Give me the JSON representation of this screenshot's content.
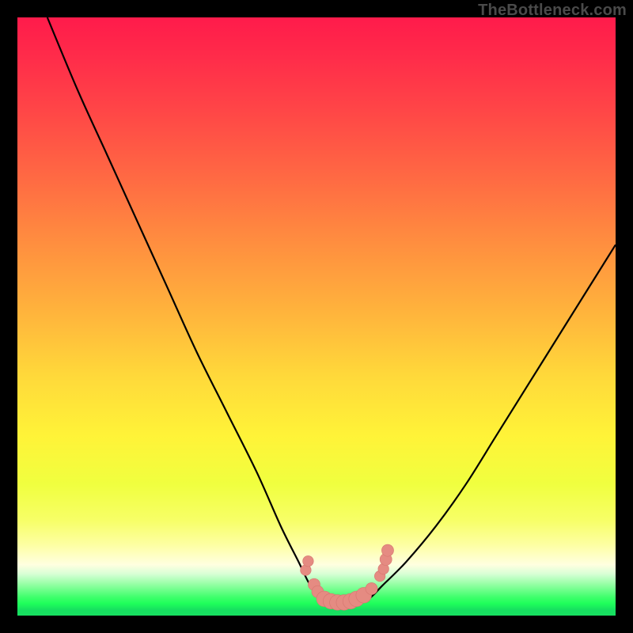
{
  "watermark": "TheBottleneck.com",
  "colors": {
    "frame": "#000000",
    "curve": "#000000",
    "marker_fill": "#e58b82",
    "marker_stroke": "#d5766f"
  },
  "chart_data": {
    "type": "line",
    "title": "",
    "xlabel": "",
    "ylabel": "",
    "xlim": [
      0,
      100
    ],
    "ylim": [
      0,
      100
    ],
    "series": [
      {
        "name": "bottleneck-curve",
        "x": [
          5,
          10,
          15,
          20,
          25,
          30,
          35,
          40,
          44,
          47,
          49,
          51,
          53,
          55,
          57,
          59,
          61,
          65,
          70,
          75,
          80,
          85,
          90,
          95,
          100
        ],
        "y": [
          100,
          88,
          77,
          66,
          55,
          44,
          34,
          24,
          15,
          9,
          5,
          3,
          2,
          2,
          2,
          3,
          5,
          9,
          15,
          22,
          30,
          38,
          46,
          54,
          62
        ]
      }
    ],
    "markers": [
      {
        "x": 48.2,
        "y": 7.6,
        "r": 0.9
      },
      {
        "x": 48.6,
        "y": 9.1,
        "r": 0.9
      },
      {
        "x": 49.6,
        "y": 5.2,
        "r": 1.0
      },
      {
        "x": 50.2,
        "y": 4.0,
        "r": 1.0
      },
      {
        "x": 51.3,
        "y": 2.8,
        "r": 1.3
      },
      {
        "x": 52.4,
        "y": 2.4,
        "r": 1.3
      },
      {
        "x": 53.5,
        "y": 2.2,
        "r": 1.3
      },
      {
        "x": 54.6,
        "y": 2.2,
        "r": 1.3
      },
      {
        "x": 55.7,
        "y": 2.4,
        "r": 1.3
      },
      {
        "x": 56.7,
        "y": 2.8,
        "r": 1.3
      },
      {
        "x": 57.9,
        "y": 3.4,
        "r": 1.3
      },
      {
        "x": 59.2,
        "y": 4.5,
        "r": 1.0
      },
      {
        "x": 60.6,
        "y": 6.6,
        "r": 0.9
      },
      {
        "x": 61.2,
        "y": 7.8,
        "r": 0.9
      },
      {
        "x": 61.6,
        "y": 9.4,
        "r": 1.0
      },
      {
        "x": 61.9,
        "y": 10.9,
        "r": 1.0
      }
    ],
    "annotations": []
  }
}
